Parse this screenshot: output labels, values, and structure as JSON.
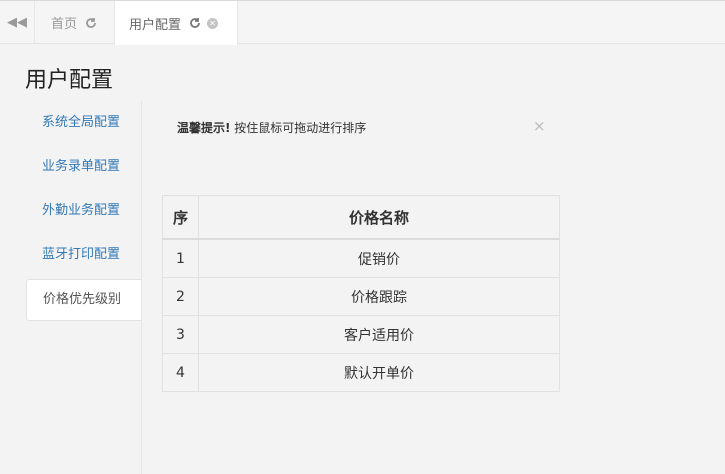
{
  "tabs": {
    "back_icon": "double-left-arrow-icon",
    "home_label": "首页",
    "active_label": "用户配置",
    "refresh_icon": "refresh-icon",
    "close_icon": "close-icon"
  },
  "page": {
    "title": "用户配置"
  },
  "sidebar": {
    "items": [
      {
        "label": "系统全局配置"
      },
      {
        "label": "业务录单配置"
      },
      {
        "label": "外勤业务配置"
      },
      {
        "label": "蓝牙打印配置"
      },
      {
        "label": "价格优先级别"
      }
    ]
  },
  "tip": {
    "strong": "温馨提示!",
    "text": " 按住鼠标可拖动进行排序",
    "close": "×"
  },
  "table": {
    "headers": [
      "序",
      "价格名称"
    ],
    "rows": [
      [
        "1",
        "促销价"
      ],
      [
        "2",
        "价格跟踪"
      ],
      [
        "3",
        "客户适用价"
      ],
      [
        "4",
        "默认开单价"
      ]
    ]
  },
  "colors": {
    "link": "#337ab7",
    "background": "#f3f3f4"
  }
}
